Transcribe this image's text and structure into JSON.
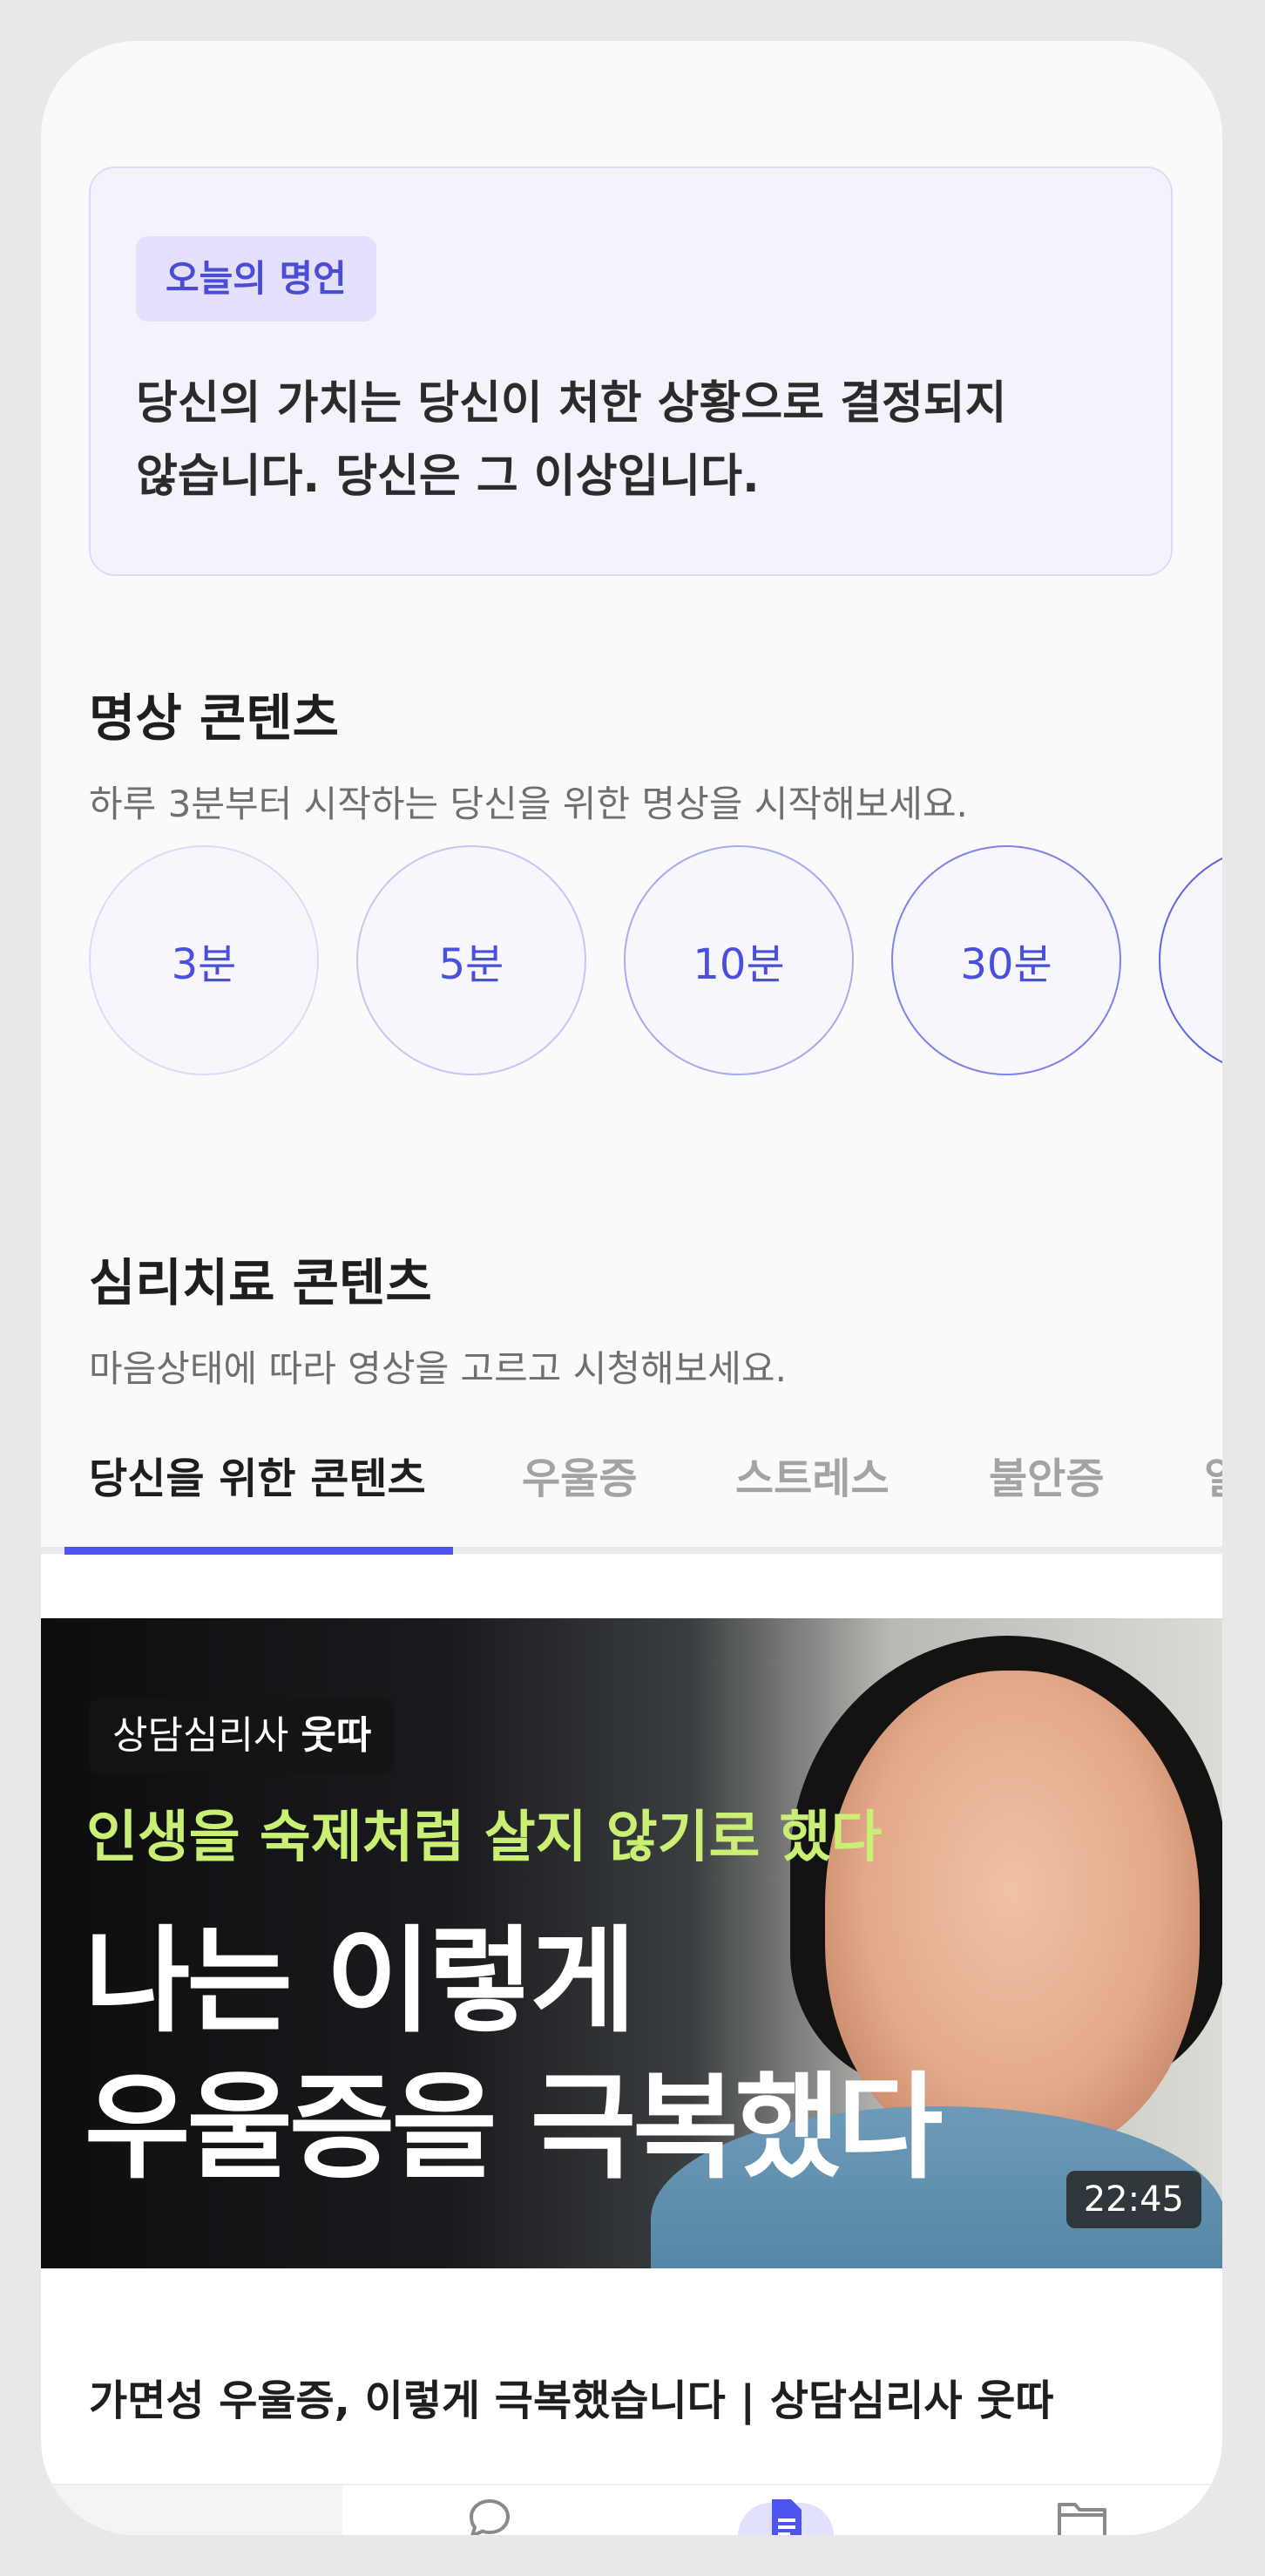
{
  "quote": {
    "badge": "오늘의 명언",
    "line1": "당신의 가치는 당신이 처한 상황으로 결정되지",
    "line2": "않습니다. 당신은 그 이상입니다."
  },
  "meditation": {
    "title": "명상 콘텐츠",
    "description": "하루 3분부터 시작하는 당신을 위한 명상을 시작해보세요.",
    "durations": [
      "3분",
      "5분",
      "10분",
      "30분"
    ]
  },
  "therapy": {
    "title": "심리치료 콘텐츠",
    "description": "마음상태에 따라 영상을 고르고 시청해보세요.",
    "tabs": [
      "당신을 위한 콘텐츠",
      "우울증",
      "스트레스",
      "불안증",
      "일"
    ]
  },
  "video": {
    "badge_prefix": "상담심리사 ",
    "badge_name": "웃따",
    "headline_small": "인생을 숙제처럼 살지 않기로 했다",
    "headline_line1": "나는 이렇게",
    "headline_line2": "우울증을 극복했다",
    "duration": "22:45",
    "title": "가면성 우울증, 이렇게 극복했습니다 | 상담심리사 웃따"
  },
  "nav": {
    "items": [
      "chat-icon",
      "document-icon",
      "folder-icon"
    ],
    "active": "document-icon"
  },
  "colors": {
    "accent": "#4e55ee",
    "headline_green": "#c9ef74"
  }
}
